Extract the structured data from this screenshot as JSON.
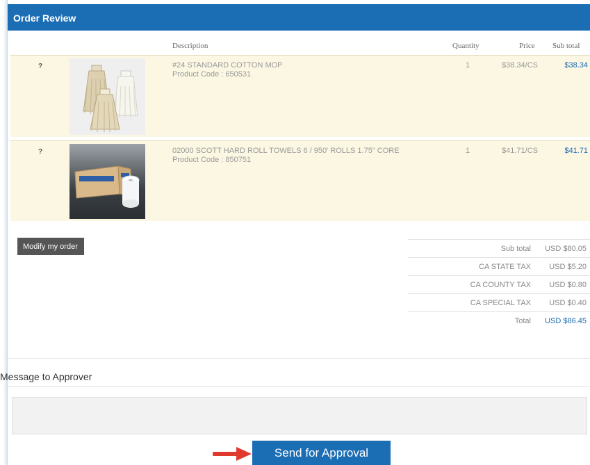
{
  "header": {
    "title": "Order Review"
  },
  "columns": {
    "description": "Description",
    "quantity": "Quantity",
    "price": "Price",
    "subtotal": "Sub total"
  },
  "items": [
    {
      "help": "?",
      "name": "#24 STANDARD COTTON MOP",
      "code": "Product Code : 650531",
      "quantity": "1",
      "price": "$38.34/CS",
      "subtotal": "$38.34",
      "image_icon": "mop-image"
    },
    {
      "help": "?",
      "name": "02000 SCOTT HARD ROLL TOWELS 6 / 950' ROLLS 1.75\" CORE",
      "code": "Product Code : 850751",
      "quantity": "1",
      "price": "$41.71/CS",
      "subtotal": "$41.71",
      "image_icon": "towel-roll-image"
    }
  ],
  "actions": {
    "modify_label": "Modify my order"
  },
  "totals": [
    {
      "label": "Sub total",
      "value": "USD $80.05"
    },
    {
      "label": "CA STATE TAX",
      "value": "USD $5.20"
    },
    {
      "label": "CA COUNTY TAX",
      "value": "USD $0.80"
    },
    {
      "label": "CA SPECIAL TAX",
      "value": "USD $0.40"
    },
    {
      "label": "Total",
      "value": "USD $86.45"
    }
  ],
  "message": {
    "label": "Message to Approver",
    "value": ""
  },
  "submit": {
    "label": "Send for Approval"
  },
  "colors": {
    "accent": "#1b6db4",
    "row_bg": "#fbf7e3",
    "arrow": "#e03a2f"
  }
}
